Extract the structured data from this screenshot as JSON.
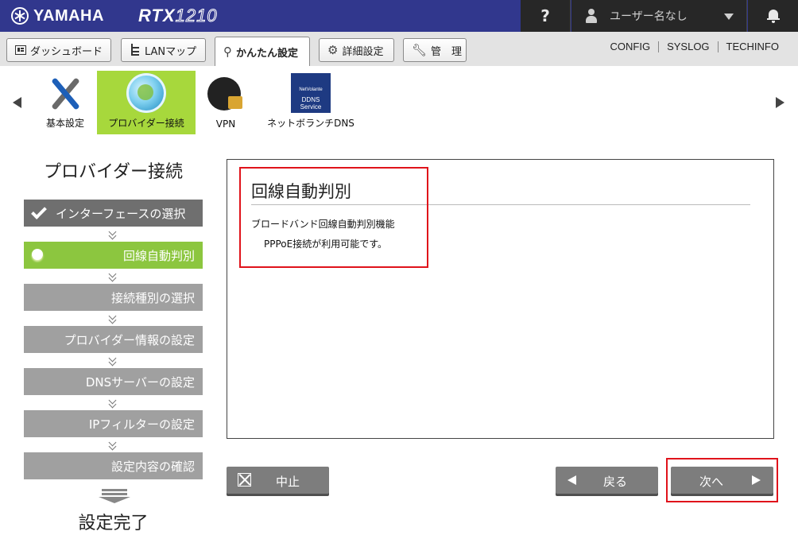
{
  "header": {
    "brand": "YAMAHA",
    "model_bold": "RTX",
    "model_thin": "1210",
    "help": "?",
    "user": "ユーザー名なし"
  },
  "tabs": [
    {
      "label": "ダッシュボード",
      "icon": "dashboard-icon"
    },
    {
      "label": "LANマップ",
      "icon": "lan-map-icon"
    },
    {
      "label": "かんたん設定",
      "icon": "wand-icon",
      "active": true
    },
    {
      "label": "詳細設定",
      "icon": "gear-icon"
    },
    {
      "label": "管　理",
      "icon": "wrench-icon"
    }
  ],
  "top_links": [
    "CONFIG",
    "SYSLOG",
    "TECHINFO"
  ],
  "wizard": [
    {
      "label": "基本設定",
      "icon": "tools-icon"
    },
    {
      "label": "プロバイダー接続",
      "icon": "globe-icon",
      "active": true
    },
    {
      "label": "VPN",
      "icon": "vpn-icon"
    },
    {
      "label": "ネットボランチDNS",
      "icon": "ddns-icon",
      "badge_top": "NetVolante",
      "badge_line1": "DDNS",
      "badge_line2": "Service"
    }
  ],
  "steps": {
    "title": "プロバイダー接続",
    "items": [
      {
        "label": "インターフェースの選択",
        "state": "done"
      },
      {
        "label": "回線自動判別",
        "state": "current"
      },
      {
        "label": "接続種別の選択",
        "state": "pending"
      },
      {
        "label": "プロバイダー情報の設定",
        "state": "pending"
      },
      {
        "label": "DNSサーバーの設定",
        "state": "pending"
      },
      {
        "label": "IPフィルターの設定",
        "state": "pending"
      },
      {
        "label": "設定内容の確認",
        "state": "pending"
      }
    ],
    "final": "設定完了"
  },
  "panel": {
    "title": "回線自動判別",
    "line1": "ブロードバンド回線自動判別機能",
    "line2": "PPPoE接続が利用可能です。"
  },
  "buttons": {
    "cancel": "中止",
    "back": "戻る",
    "next": "次へ"
  },
  "colors": {
    "header_bg": "#31378d",
    "header_dark": "#272727",
    "active_green": "#a7d83c",
    "step_current": "#8cc63f",
    "step_done": "#6f6f6f",
    "step_pending": "#a0a0a0",
    "button": "#7d7d7d",
    "highlight": "#e0131b"
  }
}
